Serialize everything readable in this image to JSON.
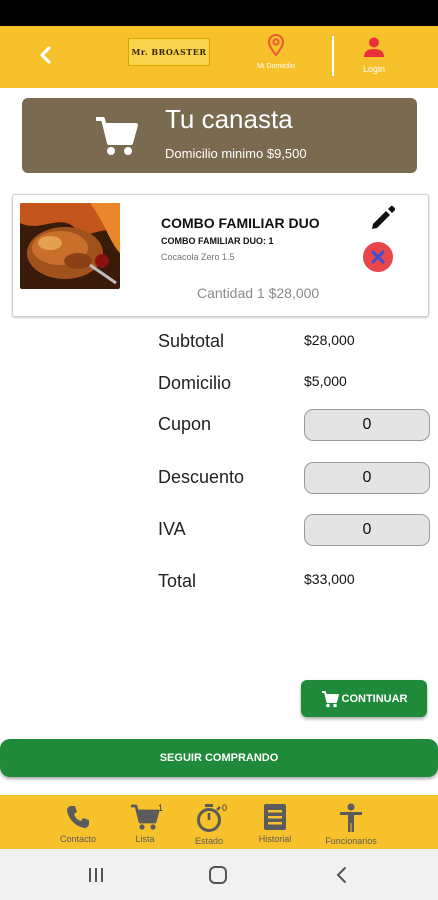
{
  "header": {
    "logo_text": "Mr. BROASTER",
    "location_label": "Mi Domicilio",
    "login_label": "Login"
  },
  "basket": {
    "title": "Tu canasta",
    "min_delivery": "Domicilio minimo $9,500"
  },
  "item": {
    "name": "COMBO FAMILIAR DUO",
    "detail": "COMBO FAMILIAR DUO: 1",
    "extra": "Cocacola Zero 1.5",
    "qty_price": "Cantidad 1 $28,000"
  },
  "summary": {
    "subtotal_label": "Subtotal",
    "subtotal_value": "$28,000",
    "delivery_label": "Domicilio",
    "delivery_value": "$5,000",
    "coupon_label": "Cupon",
    "coupon_value": "0",
    "discount_label": "Descuento",
    "discount_value": "0",
    "tax_label": "IVA",
    "tax_value": "0",
    "total_label": "Total",
    "total_value": "$33,000"
  },
  "actions": {
    "continue_label": "CONTINUAR",
    "keep_shopping_label": "SEGUIR COMPRANDO"
  },
  "bottom_nav": {
    "contact": "Contacto",
    "cart": "Lista",
    "cart_badge": "1",
    "status": "Estado",
    "status_badge": "0",
    "history": "Historial",
    "staff": "Funcionarios"
  },
  "colors": {
    "header_yellow": "#f6c12a",
    "banner_brown": "#7a6a50",
    "primary_green": "#1f8a3a",
    "remove_red": "#e8464b"
  },
  "icons": {
    "back": "chevron-left-icon",
    "location": "location-pin-icon",
    "user": "user-icon",
    "cart": "shopping-cart-icon",
    "edit": "pencil-icon",
    "remove": "close-circle-icon",
    "phone": "phone-icon",
    "timer": "stopwatch-icon",
    "history": "list-icon",
    "staff": "person-icon"
  }
}
